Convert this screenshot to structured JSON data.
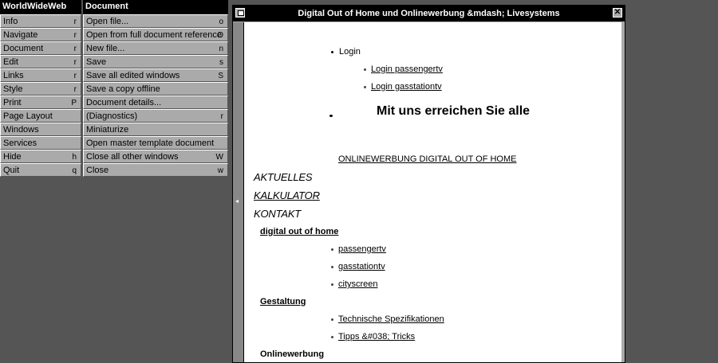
{
  "main_menu": {
    "title": "WorldWideWeb",
    "items": [
      {
        "label": "Info",
        "key": "r"
      },
      {
        "label": "Navigate",
        "key": "r"
      },
      {
        "label": "Document",
        "key": "r"
      },
      {
        "label": "Edit",
        "key": "r"
      },
      {
        "label": "Links",
        "key": "r"
      },
      {
        "label": "Style",
        "key": "r"
      },
      {
        "label": "Print",
        "key": "P"
      },
      {
        "label": "Page Layout",
        "key": ""
      },
      {
        "label": "Windows",
        "key": ""
      },
      {
        "label": "Services",
        "key": ""
      },
      {
        "label": "Hide",
        "key": "h"
      },
      {
        "label": "Quit",
        "key": "q"
      }
    ]
  },
  "document_menu": {
    "title": "Document",
    "items": [
      {
        "label": "Open file...",
        "key": "o"
      },
      {
        "label": "Open from full document reference",
        "key": "O"
      },
      {
        "label": "New file...",
        "key": "n"
      },
      {
        "label": "Save",
        "key": "s"
      },
      {
        "label": "Save all edited windows",
        "key": "S"
      },
      {
        "label": "Save a copy offline",
        "key": ""
      },
      {
        "label": "Document details...",
        "key": ""
      },
      {
        "label": "(Diagnostics)",
        "key": "r"
      },
      {
        "label": "Miniaturize",
        "key": ""
      },
      {
        "label": "Open master template document",
        "key": ""
      },
      {
        "label": "Close all other windows",
        "key": "W"
      },
      {
        "label": "Close",
        "key": "w"
      }
    ]
  },
  "window": {
    "title": "Digital Out of Home und Onlinewerbung &mdash; Livesystems",
    "close_glyph": "✕"
  },
  "page": {
    "login": "Login",
    "login_passengertv": "Login passengertv",
    "login_gasstationtv": "Login gasstationtv",
    "headline": "Mit uns erreichen Sie alle",
    "onlinewerbung_link": "ONLINEWERBUNG DIGITAL OUT OF HOME",
    "aktuelles": "AKTUELLES",
    "kalkulator": "KALKULATOR",
    "kontakt": "KONTAKT",
    "section_dooh": "digital out of home",
    "dooh_items": [
      "passengertv",
      "gasstationtv",
      "cityscreen"
    ],
    "section_gestaltung": "Gestaltung",
    "gestaltung_items": [
      "Technische Spezifikationen",
      "Tipps &#038; Tricks"
    ],
    "section_onlinewerbung": "Onlinewerbung"
  }
}
